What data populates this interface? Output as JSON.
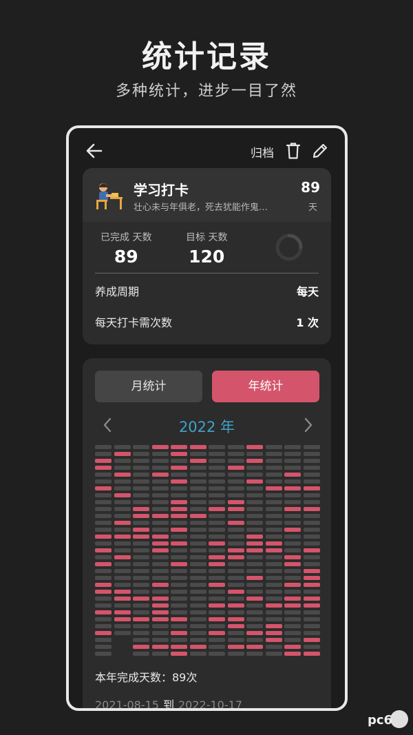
{
  "promo": {
    "title": "统计记录",
    "subtitle": "多种统计，进步一目了然"
  },
  "toolbar": {
    "archive_label": "归档"
  },
  "habit": {
    "name": "学习打卡",
    "motto": "壮心未与年俱老，死去犹能作鬼…",
    "count": "89",
    "unit": "天",
    "completed_label": "已完成 天数",
    "completed_value": "89",
    "target_label": "目标 天数",
    "target_value": "120",
    "cycle_label": "养成周期",
    "cycle_value": "每天",
    "per_day_label": "每天打卡需次数",
    "per_day_value": "1 次"
  },
  "stats": {
    "tab_month": "月统计",
    "tab_year": "年统计",
    "active_tab": "年统计",
    "year": "2022 年",
    "colors": {
      "done": "#d4556b",
      "empty": "#4a4a4a"
    },
    "summary": "本年完成天数：89次",
    "range_start": "2021-08-15",
    "range_sep": "到",
    "range_end": "2022-10-17"
  },
  "watermark": {
    "text": "pc6"
  }
}
